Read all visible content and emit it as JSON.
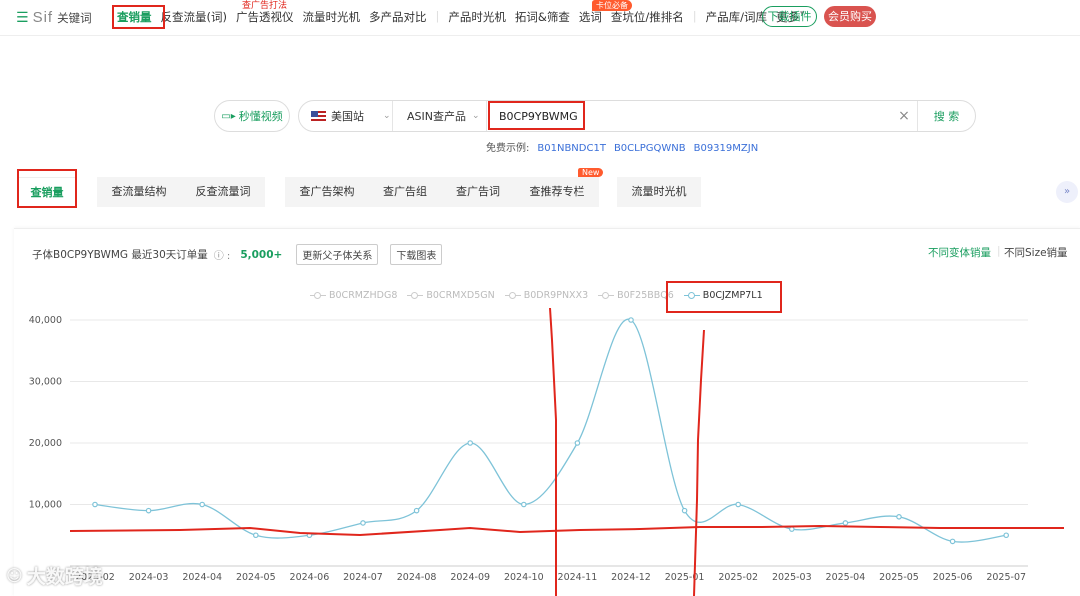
{
  "topnav": {
    "logo_text": "Sif",
    "logo_sub": "关键词",
    "items": [
      "查销量",
      "反查流量(词)",
      "广告透视仪",
      "流量时光机",
      "多产品对比",
      "|",
      "产品时光机",
      "拓词&筛查",
      "选词",
      "查坑位/推排名",
      "|",
      "产品库/词库",
      "更多"
    ],
    "tag_ads": "查广告打法",
    "tag_rank": "卡位必备",
    "download_label": "下载插件",
    "vip_label": "会员购买"
  },
  "search": {
    "video_label": "秒懂视频",
    "site": "美国站",
    "mode": "ASIN查产品",
    "value": "B0CP9YBWMG",
    "search_label": "搜 索",
    "examples_label": "免费示例:",
    "examples": [
      "B01NBNDC1T",
      "B0CLPGQWNB",
      "B09319MZJN"
    ]
  },
  "tabs": [
    "查销量",
    "查流量结构",
    "反查流量词",
    "查广告架构",
    "查广告组",
    "查广告词",
    "查推荐专栏",
    "流量时光机"
  ],
  "tab_new_badge": "New",
  "card": {
    "summary": "子体B0CP9YBWMG 最近30天订单量",
    "quantity": "5,000+",
    "btn_relation": "更新父子体关系",
    "btn_download": "下载图表",
    "toggle_variant": "不同变体销量",
    "toggle_size": "不同Size销量"
  },
  "watermark": "大数跨境",
  "chart_data": {
    "type": "line",
    "legend": [
      "B0CRMZHDG8",
      "B0CRMXD5GN",
      "B0DR9PNXX3",
      "B0F25BBQ6",
      "B0CJZMP7L1"
    ],
    "active_series": "B0CJZMP7L1",
    "x": [
      "2024-02",
      "2024-03",
      "2024-04",
      "2024-05",
      "2024-06",
      "2024-07",
      "2024-08",
      "2024-09",
      "2024-10",
      "2024-11",
      "2024-12",
      "2025-01",
      "2025-02",
      "2025-03",
      "2025-04",
      "2025-05",
      "2025-06",
      "2025-07"
    ],
    "series": [
      {
        "name": "B0CJZMP7L1",
        "values": [
          10000,
          9000,
          10000,
          5000,
          5000,
          7000,
          9000,
          20000,
          10000,
          20000,
          40000,
          9000,
          10000,
          6000,
          7000,
          8000,
          4000,
          5000
        ]
      }
    ],
    "ylim": [
      0,
      40000
    ],
    "yticks": [
      "10,000",
      "20,000",
      "30,000",
      "40,000"
    ],
    "grid": true,
    "colors": {
      "line": "#7ec3d8",
      "annotation": "#e0261c"
    }
  }
}
